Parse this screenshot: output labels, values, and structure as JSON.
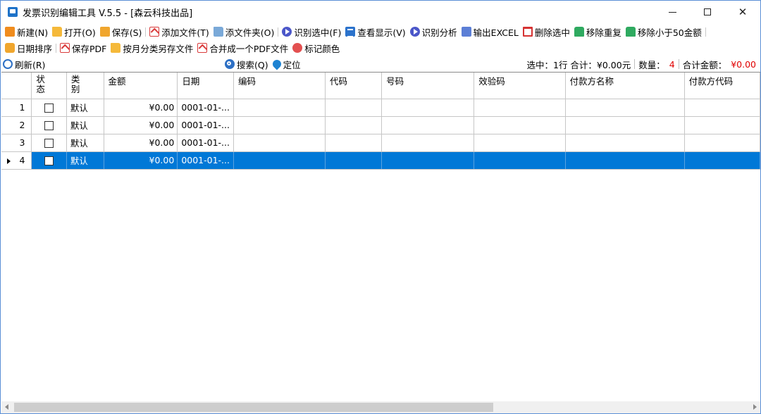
{
  "window": {
    "title": "发票识别编辑工具 V.5.5 - [森云科技出品]"
  },
  "toolbar1": [
    {
      "label": "新建(N)",
      "icon": "new-icon"
    },
    {
      "label": "打开(O)",
      "icon": "open-folder-icon"
    },
    {
      "label": "保存(S)",
      "icon": "save-icon"
    },
    {
      "label": "添加文件(T)",
      "icon": "add-file-icon"
    },
    {
      "label": "添文件夹(O)",
      "icon": "add-folder-icon"
    },
    {
      "label": "识别选中(F)",
      "icon": "recognize-icon"
    },
    {
      "label": "查看显示(V)",
      "icon": "view-list-icon"
    },
    {
      "label": "识别分析",
      "icon": "analyze-icon"
    },
    {
      "label": "输出EXCEL",
      "icon": "excel-icon"
    },
    {
      "label": "删除选中",
      "icon": "trash-icon"
    },
    {
      "label": "移除重复",
      "icon": "remove-duplicate-icon"
    },
    {
      "label": "移除小于50金额",
      "icon": "remove-small-amount-icon"
    }
  ],
  "toolbar2": [
    {
      "label": "日期排序",
      "icon": "calendar-icon"
    },
    {
      "label": "保存PDF",
      "icon": "pdf-icon"
    },
    {
      "label": "按月分类另存文件",
      "icon": "folder-icon"
    },
    {
      "label": "合并成一个PDF文件",
      "icon": "pdf-merge-icon"
    },
    {
      "label": "标记颜色",
      "icon": "palette-icon"
    }
  ],
  "statusbar": {
    "refresh_label": "刷新(R)",
    "search_label": "搜索(Q)",
    "locate_label": "定位",
    "selection_text": "选中：1行 合计：¥0.00元",
    "count_label": "数量：",
    "count_value": "4",
    "total_label": "合计金额：",
    "total_value": "¥0.00"
  },
  "grid": {
    "columns": {
      "status": "状\n态",
      "type": "类\n别",
      "amount": "金额",
      "date": "日期",
      "code_no": "编码",
      "code": "代码",
      "number": "号码",
      "check_code": "效验码",
      "payer_name": "付款方名称",
      "payer_code": "付款方代码"
    },
    "rows": [
      {
        "index": "1",
        "type": "默认",
        "amount": "¥0.00",
        "date": "0001-01-...",
        "selected": false
      },
      {
        "index": "2",
        "type": "默认",
        "amount": "¥0.00",
        "date": "0001-01-...",
        "selected": false
      },
      {
        "index": "3",
        "type": "默认",
        "amount": "¥0.00",
        "date": "0001-01-...",
        "selected": false
      },
      {
        "index": "4",
        "type": "默认",
        "amount": "¥0.00",
        "date": "0001-01-...",
        "selected": true
      }
    ]
  },
  "colors": {
    "selection": "#0078d7",
    "total_red": "#e00000",
    "window_border": "#5b8fd6"
  }
}
